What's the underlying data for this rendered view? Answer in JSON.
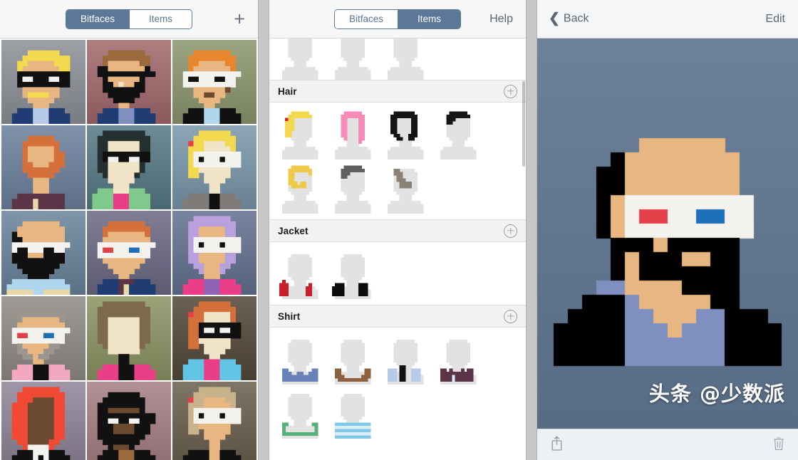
{
  "left_panel": {
    "name": "bitfaces-gallery",
    "segmented": {
      "options": [
        "Bitfaces",
        "Items"
      ],
      "selected": "Bitfaces"
    },
    "add_button_label": "+",
    "add_icon": "plus-icon",
    "avatars": [
      {
        "id": "avatar-1",
        "bg": "#8b8e92",
        "desc": "blond hair, black sunglasses, blue jacket"
      },
      {
        "id": "avatar-2",
        "bg": "#9c6c6f",
        "desc": "cap, black beard, blue jacket"
      },
      {
        "id": "avatar-3",
        "bg": "#8b9470",
        "desc": "orange hair, white glasses, black jacket"
      },
      {
        "id": "avatar-4",
        "bg": "#6e8198",
        "desc": "bald ginger beard, purple shirt"
      },
      {
        "id": "avatar-5",
        "bg": "#5b7a84",
        "desc": "black curly hair, sunglasses, green jacket"
      },
      {
        "id": "avatar-6",
        "bg": "#7b94a5",
        "desc": "blond ponytail, white glasses, grey shirt"
      },
      {
        "id": "avatar-7",
        "bg": "#6d8397",
        "desc": "black beard, white glasses, striped shirt"
      },
      {
        "id": "avatar-8",
        "bg": "#6f6d84",
        "desc": "ginger hair, 3D glasses, navy jacket"
      },
      {
        "id": "avatar-9",
        "bg": "#68738e",
        "desc": "purple hair, white glasses, pink jacket"
      },
      {
        "id": "avatar-10",
        "bg": "#8d8a86",
        "desc": "grey hair, 3D glasses, pink jacket"
      },
      {
        "id": "avatar-11",
        "bg": "#8b9167",
        "desc": "brown afro, white face, pink jacket"
      },
      {
        "id": "avatar-12",
        "bg": "#5a4f43",
        "desc": "ginger ponytail, sunglasses, cyan jacket"
      },
      {
        "id": "avatar-13",
        "bg": "#8d8496",
        "desc": "red long hair, black suit"
      },
      {
        "id": "avatar-14",
        "bg": "#a08084",
        "desc": "black hat, beard, sunglasses"
      },
      {
        "id": "avatar-15",
        "bg": "#6d6455",
        "desc": "blond ponytail, white glasses, black jacket"
      }
    ]
  },
  "mid_panel": {
    "name": "items-list",
    "segmented": {
      "options": [
        "Bitfaces",
        "Items"
      ],
      "selected": "Items"
    },
    "help_label": "Help",
    "add_icon": "circle-plus-icon",
    "clipped_section_items": 3,
    "sections": [
      {
        "title": "Hair",
        "add_label": "+",
        "items": [
          {
            "name": "hair-blond-ponytail",
            "color": "#f2d94e"
          },
          {
            "name": "hair-pink-long",
            "color": "#f58cb8"
          },
          {
            "name": "hair-black-afro",
            "color": "#151515"
          },
          {
            "name": "hair-black-short",
            "color": "#151515"
          },
          {
            "name": "hair-blond-beard",
            "color": "#efca4a"
          },
          {
            "name": "hair-grey-short",
            "color": "#5f5f5f"
          },
          {
            "name": "hair-grey-sidebeard",
            "color": "#8a8276"
          }
        ]
      },
      {
        "title": "Jacket",
        "add_label": "+",
        "items": [
          {
            "name": "jacket-red",
            "color": "#c8202b"
          },
          {
            "name": "jacket-black",
            "color": "#0d0d0d"
          }
        ]
      },
      {
        "title": "Shirt",
        "add_label": "+",
        "items": [
          {
            "name": "shirt-blue",
            "color": "#6b82b8"
          },
          {
            "name": "shirt-brown-vneck",
            "color": "#8c6140"
          },
          {
            "name": "shirt-lightblue-tie",
            "color": "#b7cbe8"
          },
          {
            "name": "shirt-plum-buttons",
            "color": "#5b3547"
          },
          {
            "name": "shirt-green-apron",
            "color": "#55b07a"
          },
          {
            "name": "shirt-striped-cyan",
            "color": "#7ec9e3"
          }
        ]
      }
    ]
  },
  "right_panel": {
    "name": "bitface-detail",
    "back_label": "Back",
    "back_icon": "chevron-left-icon",
    "edit_label": "Edit",
    "share_icon": "share-icon",
    "delete_icon": "trash-icon",
    "background_color": "#62778f",
    "avatar": {
      "name": "bitface-preview",
      "desc": "tan skin, black hair and beard, white 3D glasses with red and blue lenses, blue-grey shirt, black jacket"
    },
    "watermark": "头条 @少数派"
  },
  "colors": {
    "accent": "#5b7899",
    "nav_background": "#f7f7f7",
    "section_header": "#f2f2f2",
    "divider": "#c7c7c7",
    "preview_background": "#62778f",
    "glass_white": "#f4f2ee",
    "lens_red": "#e3404a",
    "lens_blue": "#1c6fb8"
  }
}
